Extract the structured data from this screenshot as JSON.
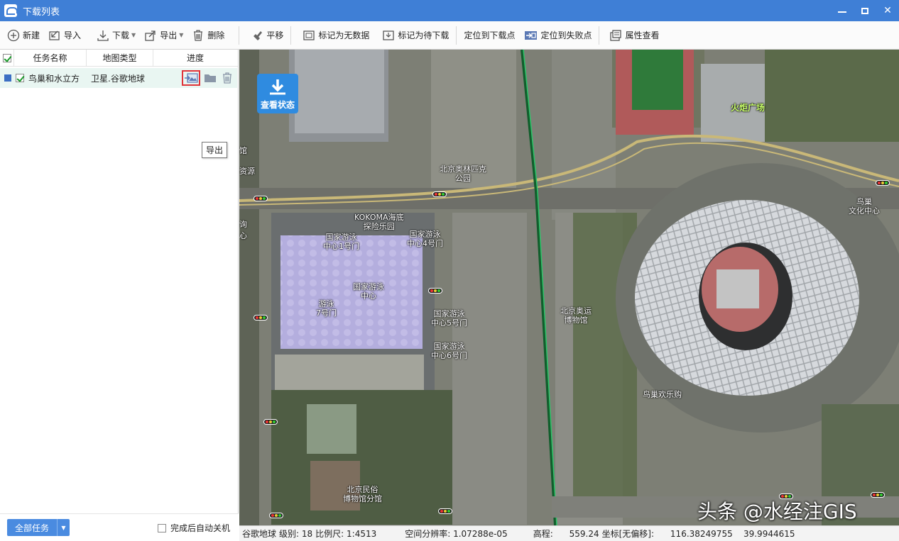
{
  "window": {
    "title": "下载列表",
    "minimize": "—",
    "maximize": "☐",
    "close": "✕"
  },
  "toolbar": {
    "new": "新建",
    "import": "导入",
    "download": "下载",
    "export": "导出",
    "delete": "删除",
    "pan": "平移",
    "mark_no_data": "标记为无数据",
    "mark_pending": "标记为待下载",
    "locate_download": "定位到下载点",
    "locate_failed": "定位到失败点",
    "properties": "属性查看"
  },
  "task_list": {
    "columns": [
      "任务名称",
      "地图类型",
      "进度"
    ],
    "rows": [
      {
        "name": "鸟巢和水立方",
        "map_type": "卫星.谷歌地球",
        "checked": true
      }
    ],
    "tooltip": "导出"
  },
  "bottom": {
    "all_tasks": "全部任务",
    "auto_shutdown": "完成后自动关机"
  },
  "map": {
    "status_button": "查看状态",
    "labels": {
      "torch_square": "火炬广场",
      "olympic_park_1": "北京奥林匹克",
      "olympic_park_2": "公园",
      "kokoma_1": "KOKOMA海底",
      "kokoma_2": "探险乐园",
      "gate1_1": "国家游泳",
      "gate1_2": "中心1号门",
      "gate4_1": "国家游泳",
      "gate4_2": "中心4号门",
      "center_1": "国家游泳",
      "center_2": "中心",
      "gate7_1": "游泳",
      "gate7_2": "7号门",
      "gate5_1": "国家游泳",
      "gate5_2": "中心5号门",
      "gate6_1": "国家游泳",
      "gate6_2": "中心6号门",
      "olympic_museum_1": "北京奥运",
      "olympic_museum_2": "博物馆",
      "folk_museum_1": "北京民俗",
      "folk_museum_2": "博物馆分馆",
      "nest_fun": "鸟巢欢乐购",
      "nest_culture_1": "鸟巢",
      "nest_culture_2": "文化中心",
      "left_1": "馆",
      "left_2": "资源",
      "left_3": "询",
      "left_4": "心"
    },
    "watermark": "头条 @水经注GIS"
  },
  "statusbar": {
    "source": "谷歌地球",
    "level": "级别: 18",
    "scale": "比例尺: 1:4513",
    "resolution": "空间分辨率: 1.07288e-05",
    "elevation": "高程:      559.24",
    "coords": "坐标[无偏移]:      116.38249755    39.9944615"
  }
}
